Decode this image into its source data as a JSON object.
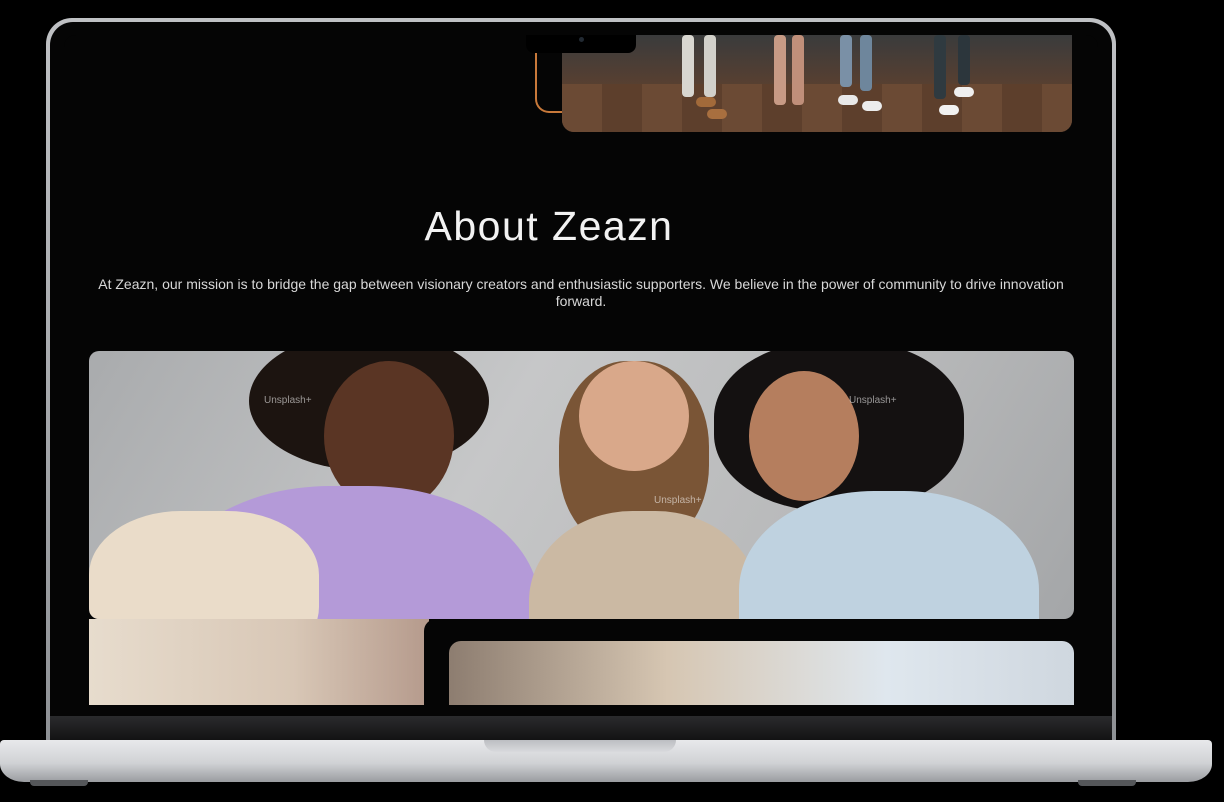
{
  "about": {
    "title": "About Zeazn",
    "description": "At Zeazn, our mission is to bridge the gap between visionary creators and enthusiastic supporters. We believe in the power of community to drive innovation forward."
  },
  "images": {
    "hero_alt": "People walking in office",
    "team_alt": "Three women laughing together",
    "watermark": "Unsplash+"
  }
}
